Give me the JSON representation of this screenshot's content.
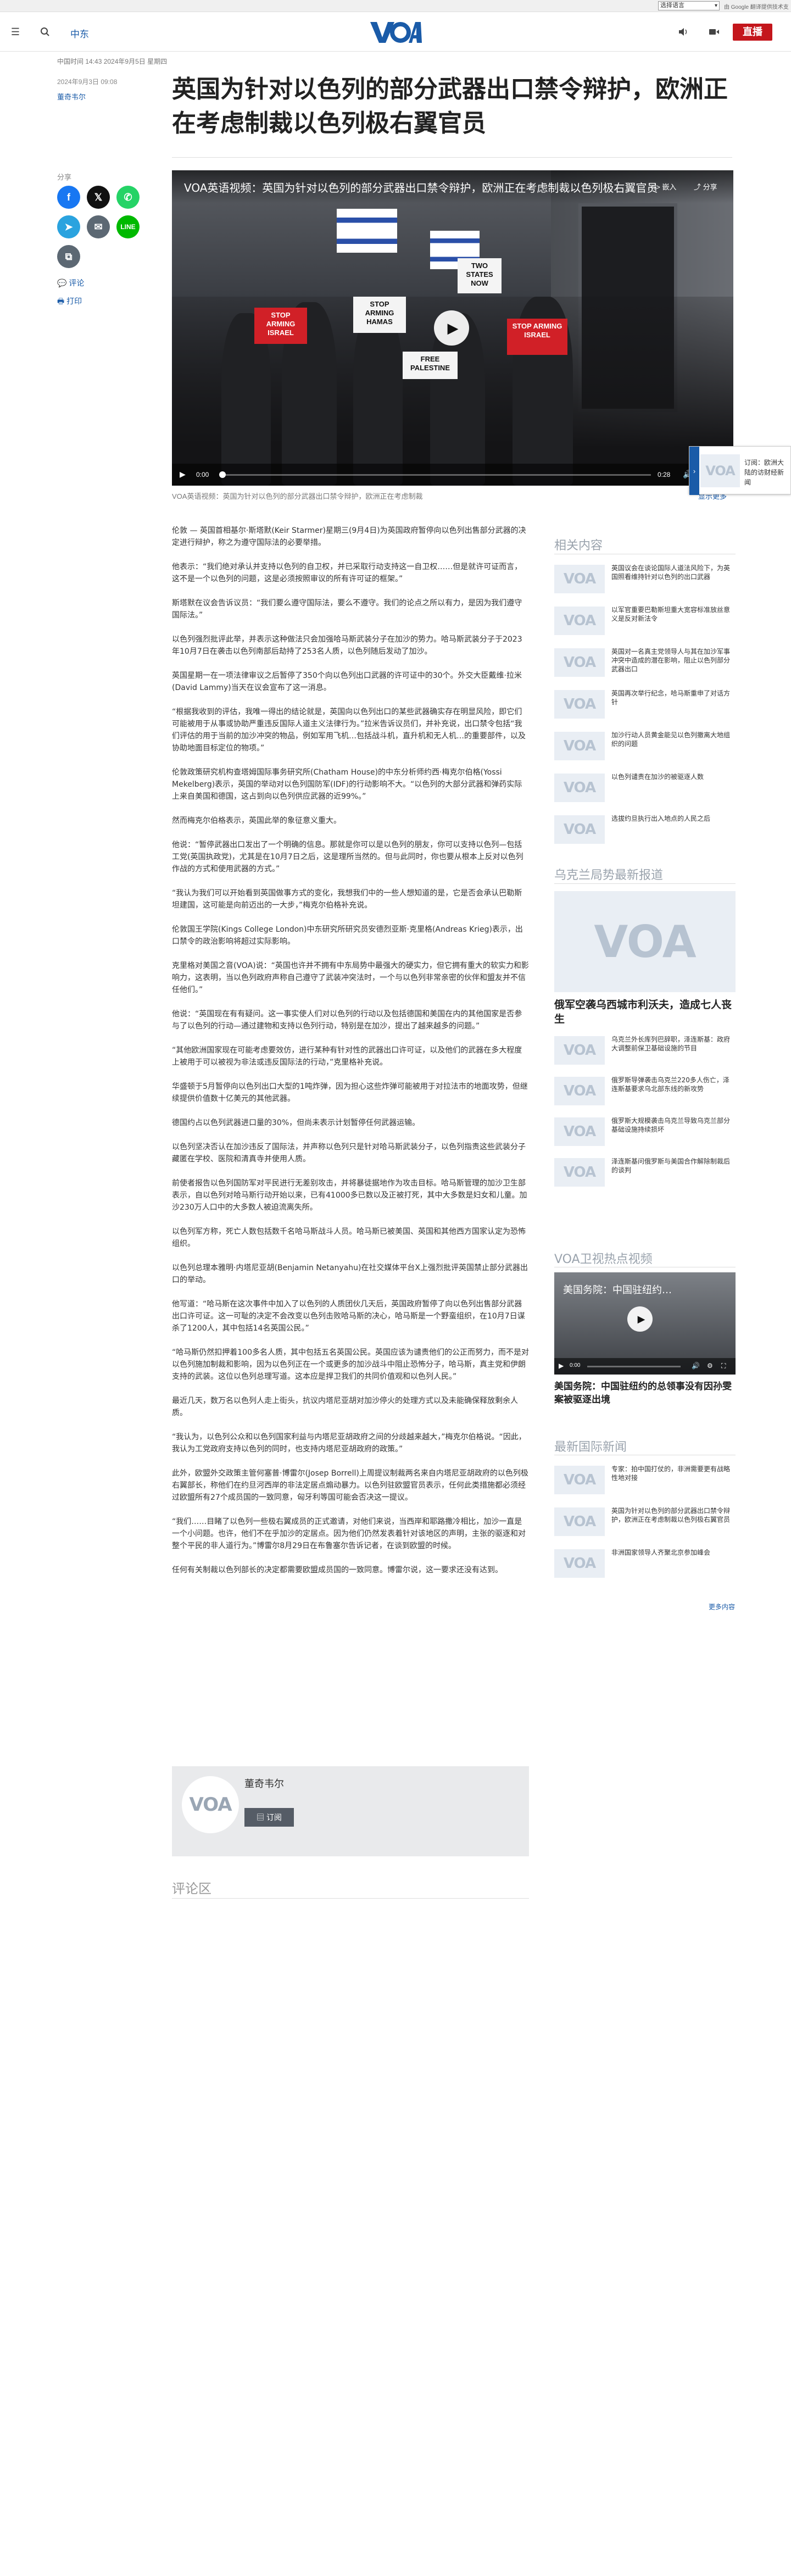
{
  "translate": {
    "select_label": "选择语言",
    "powered": "由 Google 翻译提供技术支持"
  },
  "header": {
    "section": "中东",
    "live_label": "直播",
    "logo_text": "VOA"
  },
  "meta": {
    "updated": "中国时间 14:43 2024年9月5日 星期四",
    "date": "2024年9月3日 09:08",
    "author": "董奇韦尔"
  },
  "title": "英国为针对以色列的部分武器出口禁令辩护，欧洲正在考虑制裁以色列极右翼官员",
  "share": {
    "label": "分享",
    "comments": "评论",
    "print": "打印"
  },
  "video": {
    "title": "VOA英语视频：英国为针对以色列的部分武器出口禁令辩护，欧洲正在考虑制裁以色列极右翼官员",
    "embed": "嵌入",
    "share": "分享",
    "time_current": "0:00",
    "time_total": "0:28",
    "caption": "VOA英语视频：英国为针对以色列的部分武器出口禁令辩护，欧洲正在考虑制裁",
    "more": "显示更多",
    "signs": [
      "STOP ARMING ISRAEL",
      "STOP ARMING HAMAS",
      "TWO STATES NOW",
      "STOP ARMING ISRAEL",
      "FREE PALESTINE"
    ]
  },
  "sticky": {
    "text": "订阅：欧洲大陆的访财经新闻"
  },
  "article": [
    "伦敦 — 英国首相基尔·斯塔默(Keir Starmer)星期三(9月4日)为英国政府暂停向以色列出售部分武器的决定进行辩护，称之为遵守国际法的必要举措。",
    "他表示：“我们绝对承认并支持以色列的自卫权，并已采取行动支持这一自卫权……但是就许可证而言，这不是一个以色列的问题，这是必须按照审议的所有许可证的框架。”",
    "斯塔默在议会告诉议员：“我们要么遵守国际法，要么不遵守。我们的论点之所以有力，是因为我们遵守国际法。”",
    "以色列强烈批评此举，并表示这种做法只会加强哈马斯武装分子在加沙的势力。哈马斯武装分子于2023年10月7日在袭击以色列南部后劫持了253名人质，以色列随后发动了加沙。",
    "英国星期一在一项法律审议之后暂停了350个向以色列出口武器的许可证中的30个。外交大臣戴维·拉米(David Lammy)当天在议会宣布了这一消息。",
    "“根据我收到的评估，我唯一得出的结论就是，英国向以色列出口的某些武器确实存在明显风险，即它们可能被用于从事或协助严重违反国际人道主义法律行为。”拉米告诉议员们，并补充说，出口禁令包括“我们评估的用于当前的加沙冲突的物品，例如军用飞机…包括战斗机，直升机和无人机…的重要部件，以及协助地面目标定位的物项。”",
    "伦敦政策研究机构查塔姆国际事务研究所(Chatham House)的中东分析师约西·梅克尔伯格(Yossi Mekelberg)表示，英国的举动对以色列国防军(IDF)的行动影响不大。“以色列的大部分武器和弹药实际上来自美国和德国，这占到向以色列供应武器的近99%。”",
    "然而梅克尔伯格表示，英国此举的象征意义重大。",
    "他说：“暂停武器出口发出了一个明确的信息。那就是你可以是以色列的朋友，你可以支持以色列—包括工党(英国执政党)，尤其是在10月7日之后，这是理所当然的。但与此同时，你也要从根本上反对以色列作战的方式和使用武器的方式。”",
    "“我认为我们可以开始看到英国做事方式的变化，我想我们中的一些人想知道的是，它是否会承认巴勒斯坦建国，这可能是向前迈出的一大步，”梅克尔伯格补充说。",
    "伦敦国王学院(Kings College London)中东研究所研究员安德烈亚斯·克里格(Andreas Krieg)表示，出口禁令的政治影响将超过实际影响。",
    "克里格对美国之音(VOA)说：“英国也许并不拥有中东局势中最强大的硬实力，但它拥有重大的软实力和影响力，这表明，当以色列政府声称自己遵守了武装冲突法时，一个与以色列非常亲密的伙伴和盟友并不信任他们。”",
    "他说：“英国现在有有疑问。这一事实使人们对以色列的行动以及包括德国和美国在内的其他国家是否参与了以色列的行动—通过建物和支持以色列行动，特别是在加沙，提出了越来越多的问题。”",
    "“其他欧洲国家现在可能考虑要效仿，进行某种有针对性的武器出口许可证，以及他们的武器在多大程度上被用于可以被视为非法或违反国际法的行动，”克里格补充说。",
    "华盛顿于5月暂停向以色列出口大型的1吨炸弹，因为担心这些炸弹可能被用于对拉法市的地面攻势，但继续提供价值数十亿美元的其他武器。",
    "德国约占以色列武器进口量的30%，但尚未表示计划暂停任何武器运输。",
    "以色列坚决否认在加沙违反了国际法，并声称以色列只是针对哈马斯武装分子，以色列指责这些武装分子藏匿在学校、医院和清真寺并使用人质。",
    "前使者报告以色列国防军对平民进行无差别攻击，并将暴徒据地作为攻击目标。哈马斯管理的加沙卫生部表示，自以色列对哈马斯行动开始以来，已有41000多已数以及正被打死，其中大多数是妇女和儿童。加沙230万人口中的大多数人被迫流离失所。",
    "以色列军方称，死亡人数包括数千名哈马斯战斗人员。哈马斯已被美国、英国和其他西方国家认定为恐怖组织。",
    "以色列总理本雅明·内塔尼亚胡(Benjamin Netanyahu)在社交媒体平台X上强烈批评英国禁止部分武器出口的举动。",
    "他写道：“哈马斯在这次事件中加入了以色列的人质团伙几天后，英国政府暂停了向以色列出售部分武器出口许可证。这一可耻的决定不会改变以色列击败哈马斯的决心，哈马斯是一个野蛮组织，在10月7日谋杀了1200人，其中包括14名英国公民。”",
    "“哈马斯仍然扣押着100多名人质，其中包括五名英国公民。英国应该为谴责他们的公正而努力，而不是对以色列施加制裁和影响，因为以色列正在一个或更多的加沙战斗中阻止恐怖分子，哈马斯，真主党和伊朗支持的武装。这位以色列总理写道。这本应是捍卫我们的共同价值观和以色列人民。”",
    "最近几天，数万名以色列人走上街头，抗议内塔尼亚胡对加沙停火的处理方式以及未能确保释放剩余人质。",
    "“我认为，以色列公众和以色列国家利益与内塔尼亚胡政府之间的分歧越来越大，”梅克尔伯格说。“因此，我认为工党政府支持以色列的同时，也支持内塔尼亚胡政府的政策。”",
    "此外，欧盟外交政策主管何塞普·博雷尔(Josep Borrell)上周提议制裁两名来自内塔尼亚胡政府的以色列极右翼部长，称他们在约旦河西岸的非法定居点煽动暴力。以色列驻欧盟官员表示，任何此类措施都必须经过欧盟所有27个成员国的一致同意，匈牙利等国可能会否决这一提议。",
    "“我们……目睹了以色列一些极右翼成员的正式邀请，对他们来说，当西岸和耶路撒冷相比，加沙一直是一个小问题。也许，他们不在乎加沙的定居点。因为他们仍然发表着针对该地区的声明，主张的驱逐和对整个平民的非人道行为。”博雷尔8月29日在布鲁塞尔告诉记者，在谈到欧盟的时候。",
    "任何有关制裁以色列部长的决定都需要欧盟成员国的一致同意。博雷尔说，这一要求还没有达到。"
  ],
  "author_box": {
    "name": "董奇韦尔",
    "subscribe": "订阅"
  },
  "comments": {
    "heading": "评论区"
  },
  "sidebar": {
    "related_head": "相关内容",
    "related": [
      "英国议会在谈论国际人道法风险下，为英国照看维持针对以色列的出口武器",
      "以军官重要巴勒斯坦重大宽容标准放丝意义是反对新法令",
      "英国对一名真主党领导人与其在加沙军事冲突中造成的潜在影响，阻止以色列部分武器出口",
      "英国再次举行纪念，哈马斯重申了对话方针",
      "加沙行动人员黄金能见以色列撤离大地组织的问题",
      "以色列谴责在加沙的被驱逐人数",
      "选拔约旦执行出入地点的人民之后"
    ],
    "ukraine_head": "乌克兰局势最新报道",
    "ukraine_feature": "俄军空袭乌西城市利沃夫，造成七人丧生",
    "ukraine": [
      "乌克兰外长库列巴辞职，泽连斯基：政府大调整前保卫基础设施的节目",
      "俄罗斯导弹袭击乌克兰220多人伤亡，泽连斯基要求乌北部东线的新攻势",
      "俄罗斯大规模袭击乌克兰导致乌克兰部分基础设施持续损坏",
      "泽连斯基问俄罗斯与美国合作解除制裁后的谈判"
    ],
    "video_head": "VOA卫视热点视频",
    "video_overlay": "美国务院：中国驻纽约…",
    "video_time": "0:00",
    "video_feature": "美国务院：中国驻纽约的总领事没有因孙雯案被驱逐出境",
    "intl_head": "最新国际新闻",
    "intl": [
      "专家：拍中国打仗的，非洲需要更有战略性地对接",
      "英国为针对以色列的部分武器出口禁令辩护，欧洲正在考虑制裁以色列极右翼官员",
      "非洲国家领导人齐聚北京参加峰会"
    ],
    "more_news": "更多内容"
  },
  "colors": {
    "brand": "#1a5ba8",
    "live": "#c4161c",
    "facebook": "#1877f2",
    "x": "#111111",
    "whatsapp": "#25d366",
    "telegram": "#2aa3df",
    "email": "#5c6873",
    "line": "#00b900"
  }
}
